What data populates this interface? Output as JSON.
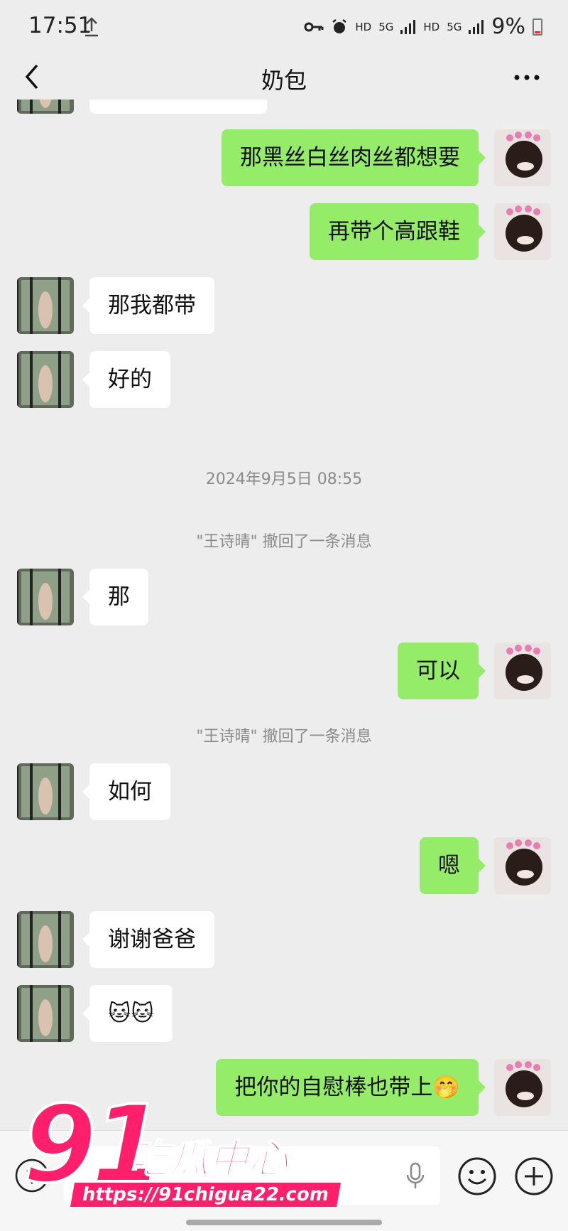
{
  "status_bar": {
    "time": "17:51",
    "network_labels": [
      "HD",
      "5G",
      "HD",
      "5G"
    ],
    "battery": "9%"
  },
  "header": {
    "title": "奶包"
  },
  "messages": [
    {
      "side": "right",
      "text": "那黑丝白丝肉丝都想要"
    },
    {
      "side": "right",
      "text": "再带个高跟鞋"
    },
    {
      "side": "left",
      "text": "那我都带"
    },
    {
      "side": "left",
      "text": "好的"
    },
    {
      "type": "timestamp",
      "text": "2024年9月5日 08:55"
    },
    {
      "type": "recall",
      "text": "\"王诗晴\" 撤回了一条消息"
    },
    {
      "side": "left",
      "text": "那"
    },
    {
      "side": "right",
      "text": "可以"
    },
    {
      "type": "recall",
      "text": "\"王诗晴\" 撤回了一条消息"
    },
    {
      "side": "left",
      "text": "如何"
    },
    {
      "side": "right",
      "text": "嗯"
    },
    {
      "side": "left",
      "text": "谢谢爸爸"
    },
    {
      "side": "left",
      "text": "🐱🐱"
    },
    {
      "side": "right",
      "text": "把你的自慰棒也带上🤭"
    }
  ],
  "input_bar": {
    "placeholder": ""
  },
  "watermark": {
    "number": "91",
    "name": "吃瓜中心",
    "url": "https://91chigua22.com"
  },
  "colors": {
    "background": "#ededed",
    "sent_bubble": "#95ec69",
    "received_bubble": "#ffffff",
    "watermark": "#ff1f6a"
  },
  "icons": [
    "upload-icon",
    "key-icon",
    "alarm-icon",
    "signal-icon",
    "back-icon",
    "more-icon",
    "voice-icon",
    "mic-icon",
    "emoji-icon",
    "plus-icon"
  ]
}
